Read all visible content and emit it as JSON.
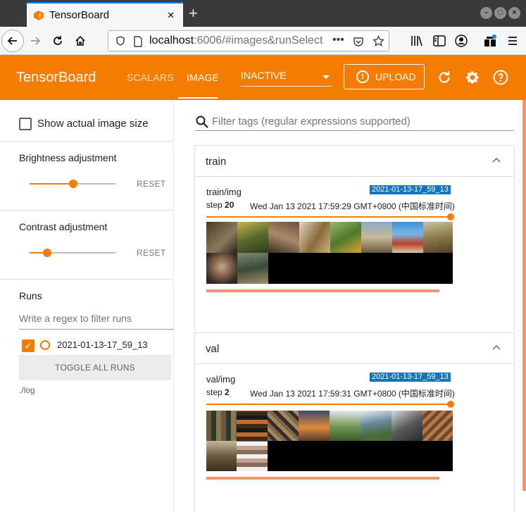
{
  "browser": {
    "tab_title": "TensorBoard",
    "url_host": "localhost",
    "url_rest": ":6006/#images&runSelect",
    "new_tab": "+",
    "close_tab": "✕"
  },
  "header": {
    "brand": "TensorBoard",
    "tabs": [
      {
        "label": "SCALARS",
        "active": false
      },
      {
        "label": "IMAGE",
        "active": true
      }
    ],
    "select_value": "INACTIVE",
    "upload_label": "UPLOAD"
  },
  "sidebar": {
    "show_actual_size": "Show actual image size",
    "brightness": {
      "label": "Brightness adjustment",
      "reset": "RESET",
      "value": 0.5
    },
    "contrast": {
      "label": "Contrast adjustment",
      "reset": "RESET",
      "value": 0.2
    },
    "runs_heading": "Runs",
    "filter_placeholder": "Write a regex to filter runs",
    "runs": [
      {
        "name": "2021-01-13-17_59_13",
        "checked": true
      }
    ],
    "toggle_all": "TOGGLE ALL RUNS",
    "logdir": "./log"
  },
  "main": {
    "search_placeholder": "Filter tags (regular expressions supported)",
    "groups": [
      {
        "title": "train",
        "card": {
          "tag": "train/img",
          "run": "2021-01-13-17_59_13",
          "step_label": "step",
          "step": "20",
          "walltime": "Wed Jan 13 2021 17:59:29 GMT+0800 (中国标准时间)"
        }
      },
      {
        "title": "val",
        "card": {
          "tag": "val/img",
          "run": "2021-01-13-17_59_13",
          "step_label": "step",
          "step": "2",
          "walltime": "Wed Jan 13 2021 17:59:31 GMT+0800 (中国标准时间)"
        }
      }
    ]
  },
  "colors": {
    "accent": "#f57c00",
    "run_chip": "#0b76c1"
  }
}
